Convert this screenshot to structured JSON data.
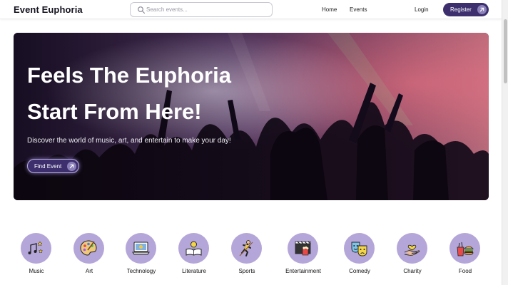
{
  "header": {
    "brand": "Event Euphoria",
    "search_placeholder": "Search events...",
    "nav": {
      "home": "Home",
      "events": "Events"
    },
    "login": "Login",
    "register": "Register"
  },
  "hero": {
    "title_line1": "Feels The Euphoria",
    "title_line2": "Start From Here!",
    "subtitle": "Discover the world of music, art, and entertain to make your day!",
    "cta": "Find Event"
  },
  "categories": [
    {
      "label": "Music",
      "icon": "music-notes-icon"
    },
    {
      "label": "Art",
      "icon": "paint-palette-icon"
    },
    {
      "label": "Technology",
      "icon": "laptop-icon"
    },
    {
      "label": "Literature",
      "icon": "book-lightbulb-icon"
    },
    {
      "label": "Sports",
      "icon": "athlete-icon"
    },
    {
      "label": "Entertainment",
      "icon": "cinema-clapper-icon"
    },
    {
      "label": "Comedy",
      "icon": "theater-masks-icon"
    },
    {
      "label": "Charity",
      "icon": "giving-hand-icon"
    },
    {
      "label": "Food",
      "icon": "food-icon"
    }
  ],
  "colors": {
    "brand_primary": "#3d2f6e",
    "category_circle": "#b4a6d8",
    "arrow_badge": "#8c80b8"
  }
}
